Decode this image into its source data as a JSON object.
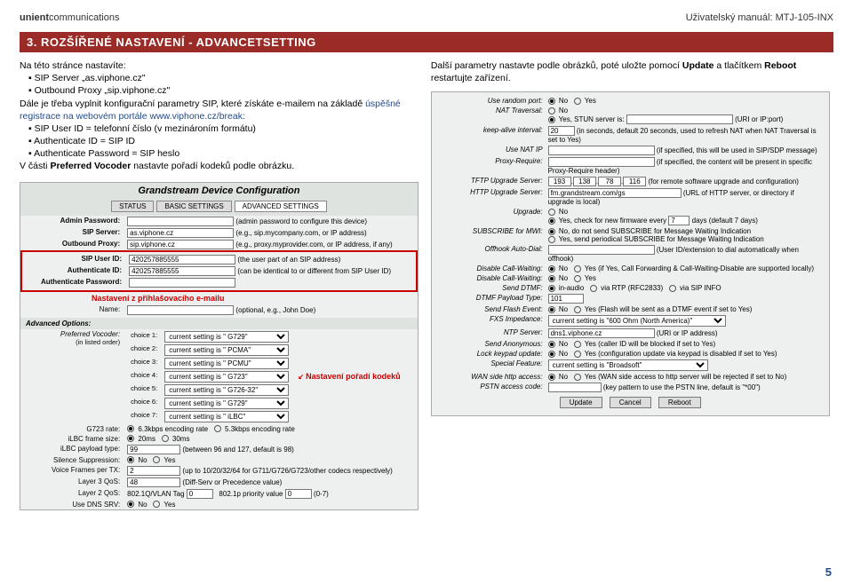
{
  "header": {
    "logo_bold": "unient",
    "logo_rest": "communications",
    "manual": "Uživatelský manuál: MTJ-105-INX"
  },
  "section": "3. ROZŠÍŘENÉ NASTAVENÍ - ADVANCETSETTING",
  "left": {
    "p1": "Na této stránce nastavíte:",
    "b1": "SIP Server „as.viphone.cz\"",
    "b2": "Outbound Proxy „sip.viphone.cz\"",
    "p2a": "Dále je třeba vyplnit konfigurační parametry SIP, které získáte e-mailem na základě ",
    "p2b": "úspěšné registrace na webovém portále www.viphone.cz/break:",
    "b3": "SIP User ID = telefonní číslo (v mezinároním formátu)",
    "b4": "Authenticate ID = SIP ID",
    "b5": "Authenticate Password = SIP heslo",
    "p3a": "V části ",
    "p3b": "Preferred Vocoder",
    "p3c": " nastavte pořadí kodeků podle obrázku."
  },
  "dc": {
    "title": "Grandstream Device Configuration",
    "tabs": {
      "t1": "STATUS",
      "t2": "BASIC SETTINGS",
      "t3": "ADVANCED SETTINGS"
    },
    "rows": {
      "admin": {
        "lab": "Admin Password:",
        "hint": "(admin password to configure this device)"
      },
      "sip": {
        "lab": "SIP Server:",
        "val": "as.viphone.cz",
        "hint": "(e.g., sip.mycompany.com, or IP address)"
      },
      "proxy": {
        "lab": "Outbound Proxy:",
        "val": "sip.viphone.cz",
        "hint": "(e.g., proxy.myprovider.com, or IP address, if any)"
      },
      "userid": {
        "lab": "SIP User ID:",
        "val": "420257885555",
        "hint": "(the user part of an SIP address)"
      },
      "authid": {
        "lab": "Authenticate ID:",
        "val": "420257885555",
        "hint": "(can be identical to or different from SIP User ID)"
      },
      "authpw": {
        "lab": "Authenticate Password:"
      },
      "red1": "Nastavení z přihlašovacího e-mailu",
      "name": {
        "lab": "Name:",
        "hint": "(optional, e.g., John Doe)"
      }
    },
    "adv_head": "Advanced Options:",
    "voc": {
      "lab": "Preferred Vocoder:",
      "sub": "(in listed order)",
      "c": [
        "choice 1:",
        "choice 2:",
        "choice 3:",
        "choice 4:",
        "choice 5:",
        "choice 6:",
        "choice 7:"
      ],
      "v": [
        "current setting is \" G729\"",
        "current setting is \" PCMA\"",
        "current setting is \" PCMU\"",
        "current setting is \" G723\"",
        "current setting is \" G726-32\"",
        "current setting is \" G729\"",
        "current setting is \" iLBC\""
      ]
    },
    "red2": "Nastavení pořadí kodeků",
    "g723": {
      "lab": "G723 rate:",
      "a": "6.3kbps encoding rate",
      "b": "5.3kbps encoding rate"
    },
    "ilbcf": {
      "lab": "iLBC frame size:",
      "a": "20ms",
      "b": "30ms"
    },
    "ilbcp": {
      "lab": "iLBC payload type:",
      "val": "99",
      "hint": "(between 96 and 127, default is 98)"
    },
    "sil": {
      "lab": "Silence Suppression:",
      "a": "No",
      "b": "Yes"
    },
    "vft": {
      "lab": "Voice Frames per TX:",
      "val": "2",
      "hint": "(up to 10/20/32/64 for G711/G726/G723/other codecs respectively)"
    },
    "l3q": {
      "lab": "Layer 3 QoS:",
      "val": "48",
      "hint": "(Diff-Serv or Precedence value)"
    },
    "l2q": {
      "lab": "Layer 2 QoS:",
      "a": "802.1Q/VLAN Tag",
      "av": "0",
      "b": "802.1p priority value",
      "bv": "0",
      "hint": "(0-7)"
    },
    "dns": {
      "lab": "Use DNS SRV:",
      "a": "No",
      "b": "Yes"
    }
  },
  "right": {
    "p1a": "Další parametry nastavte podle obrázků, poté uložte pomocí ",
    "p1b": "Update",
    "p1c": " a tlačítkem ",
    "p1d": "Reboot",
    "p1e": " restartujte zařízení."
  },
  "panel": {
    "rand": {
      "lab": "Use random port:",
      "a": "No",
      "b": "Yes"
    },
    "nat": {
      "lab": "NAT Traversal:",
      "a": "No",
      "b": "Yes, STUN server is:",
      "hint": "(URI or IP:port)"
    },
    "keep": {
      "lab": "keep-alive interval:",
      "val": "20",
      "hint": "(in seconds, default 20 seconds, used to refresh NAT when NAT Traversal is set to Yes)"
    },
    "natip": {
      "lab": "Use NAT IP",
      "hint": "(if specified, this will be used in SIP/SDP message)"
    },
    "preq": {
      "lab": "Proxy-Require:",
      "hint": "(if specified, the content will be present in specific Proxy-Require header)"
    },
    "tftp": {
      "lab": "TFTP Upgrade Server:",
      "ip": [
        "193",
        "138",
        "78",
        "116"
      ],
      "hint": "(for remote software upgrade and configuration)"
    },
    "http": {
      "lab": "HTTP Upgrade Server:",
      "val": "fm.grandstream.com/gs",
      "hint": "(URL of HTTP server, or directory if upgrade is local)"
    },
    "upg": {
      "lab": "Upgrade:",
      "a": "No",
      "b": "Yes, check for new firmware every",
      "val": "7",
      "hint": "days (default 7 days)"
    },
    "mwi": {
      "lab": "SUBSCRIBE for MWI:",
      "a": "No, do not send SUBSCRIBE for Message Waiting Indication",
      "b": "Yes, send periodical SUBSCRIBE for Message Waiting Indication"
    },
    "off": {
      "lab": "Offhook Auto-Dial:",
      "hint": "(User ID/extension to dial automatically when offhook)"
    },
    "fwd": {
      "lab": "Disable Call-Waiting:",
      "a": "No",
      "b": "Yes (if Yes, Call Forwarding & Call-Waiting-Disable are supported locally)"
    },
    "dcw": {
      "lab": "Disable Call-Waiting:",
      "a": "No",
      "b": "Yes"
    },
    "dtmf": {
      "lab": "Send DTMF:",
      "a": "in-audio",
      "b": "via RTP (RFC2833)",
      "c": "via SIP INFO"
    },
    "dpt": {
      "lab": "DTMF Payload Type:",
      "val": "101"
    },
    "flash": {
      "lab": "Send Flash Event:",
      "a": "No",
      "b": "Yes  (Flash will be sent as a DTMF event if set to Yes)"
    },
    "fxs": {
      "lab": "FXS Impedance:",
      "val": "current setting is \"600 Ohm (North America)\""
    },
    "ntp": {
      "lab": "NTP Server:",
      "val": "dns1.viphone.cz",
      "hint": "(URI or IP address)"
    },
    "anon": {
      "lab": "Send Anonymous:",
      "a": "No",
      "b": "Yes  (caller ID will be blocked if set to Yes)"
    },
    "lock": {
      "lab": "Lock keypad update:",
      "a": "No",
      "b": "Yes  (configuration update via keypad is disabled if set to Yes)"
    },
    "spec": {
      "lab": "Special Feature:",
      "val": "current setting is \"Broadsoft\""
    },
    "wan": {
      "lab": "WAN side http access:",
      "a": "No",
      "b": "Yes  (WAN side access to http server will be rejected if set to No)"
    },
    "pstn": {
      "lab": "PSTN access code:",
      "hint": "(key pattern to use the PSTN line, default is \"*00\")"
    },
    "btn": {
      "u": "Update",
      "c": "Cancel",
      "r": "Reboot"
    }
  },
  "page_num": "5"
}
